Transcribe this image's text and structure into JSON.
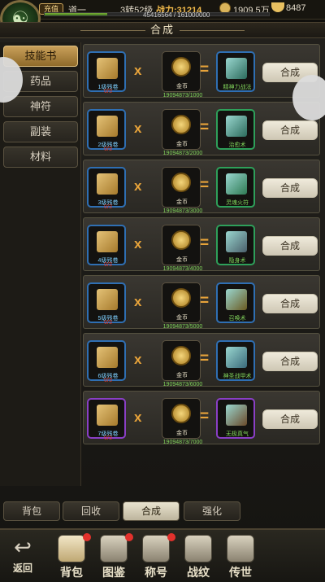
{
  "header": {
    "avatar_glyph": "☯",
    "vip_label": "充值",
    "player_name": "道一",
    "level_text": "3转52级",
    "power_text": "战力:31214",
    "gold_text": "1909.5万",
    "ingot_text": "8487",
    "exp_text": "45416564 / 161000000",
    "exp_progress": 0.28
  },
  "title": "合成",
  "sidebar": {
    "items": [
      {
        "label": "技能书",
        "active": true
      },
      {
        "label": "药品"
      },
      {
        "label": "神符"
      },
      {
        "label": "副装"
      },
      {
        "label": "材料"
      }
    ]
  },
  "recipes": [
    {
      "src_name": "1级残卷",
      "src_count": "0/3",
      "coin_name": "金币",
      "coin_req": "19094873/1000",
      "dst_name": "精神力战法",
      "button": "合成"
    },
    {
      "src_name": "2级残卷",
      "src_count": "0/3",
      "coin_name": "金币",
      "coin_req": "19094873/2000",
      "dst_name": "治愈术",
      "button": "合成"
    },
    {
      "src_name": "3级残卷",
      "src_count": "0/3",
      "coin_name": "金币",
      "coin_req": "19094873/3000",
      "dst_name": "灵魂火符",
      "button": "合成"
    },
    {
      "src_name": "4级残卷",
      "src_count": "0/3",
      "coin_name": "金币",
      "coin_req": "19094873/4000",
      "dst_name": "隐身术",
      "button": "合成"
    },
    {
      "src_name": "5级残卷",
      "src_count": "0/3",
      "coin_name": "金币",
      "coin_req": "19094873/5000",
      "dst_name": "召唤术",
      "button": "合成"
    },
    {
      "src_name": "6级残卷",
      "src_count": "0/3",
      "coin_name": "金币",
      "coin_req": "19094873/6000",
      "dst_name": "神圣战甲术",
      "button": "合成"
    },
    {
      "src_name": "7级残卷",
      "src_count": "0/3",
      "coin_name": "金币",
      "coin_req": "19094873/7000",
      "dst_name": "无极真气",
      "button": "合成"
    }
  ],
  "bottom_tabs": [
    {
      "label": "背包"
    },
    {
      "label": "回收"
    },
    {
      "label": "合成",
      "active": true
    },
    {
      "label": "强化"
    }
  ],
  "footer": {
    "back_label": "返回",
    "items": [
      {
        "label": "背包",
        "icon": "bag-icon",
        "badge": true
      },
      {
        "label": "图鉴",
        "icon": "book-icon",
        "badge": true
      },
      {
        "label": "称号",
        "icon": "title-icon",
        "badge": true
      },
      {
        "label": "战纹",
        "icon": "rune-icon"
      },
      {
        "label": "传世",
        "icon": "legacy-icon"
      }
    ]
  },
  "colors": {
    "accent_gold": "#e7a33a",
    "green_text": "#7fd05a",
    "red_text": "#e03a30",
    "blue_border": "#2f6fb3",
    "purple_border": "#8a3fc6"
  }
}
